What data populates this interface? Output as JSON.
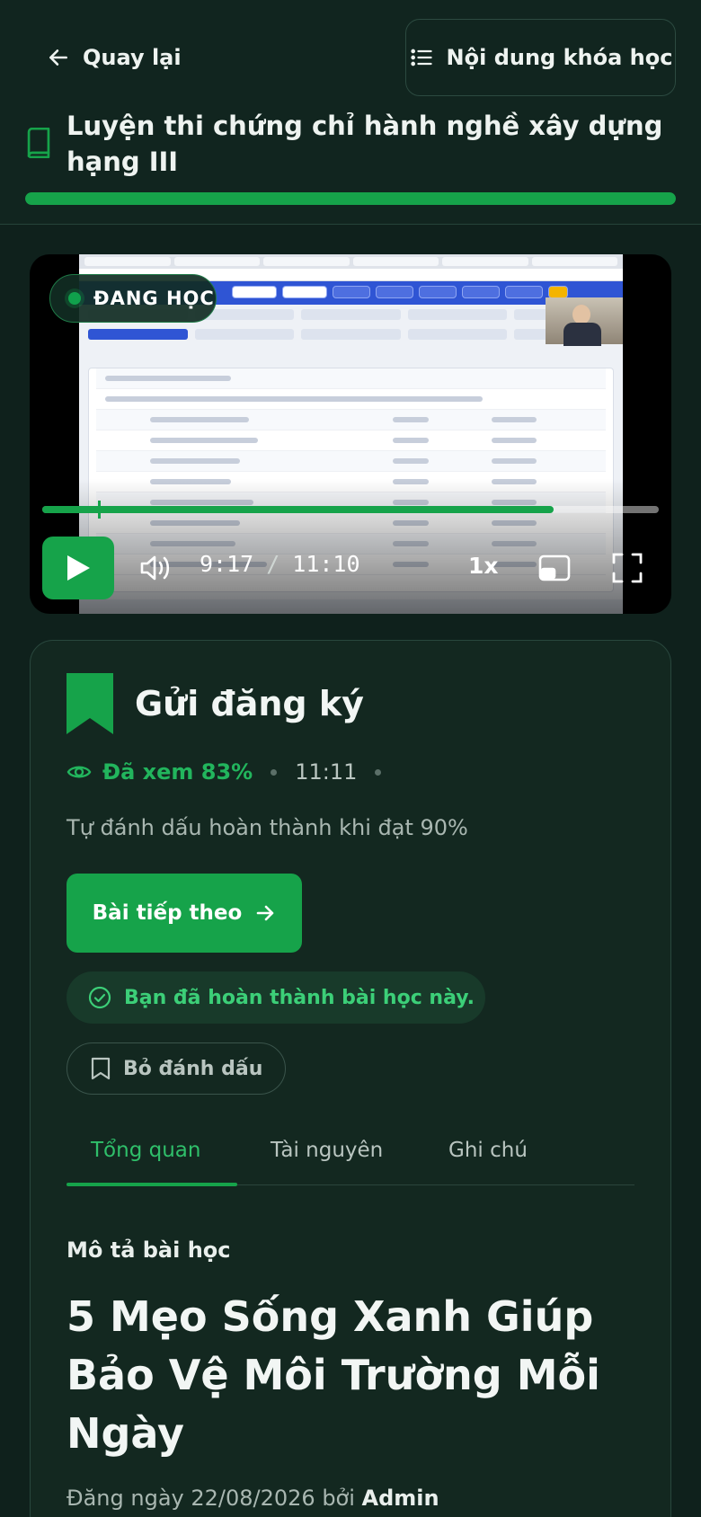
{
  "header": {
    "back_label": "Quay lại",
    "course_content_label": "Nội dung khóa học",
    "course_title": "Luyện thi chứng chỉ hành nghề xây dựng hạng III",
    "course_progress": 1.0
  },
  "player": {
    "status_badge": "ĐANG HỌC",
    "current_time": "9:17",
    "separator": "/",
    "duration": "11:10",
    "speed": "1x",
    "played_fraction": 0.83,
    "accent_color": "#16a34a"
  },
  "lesson": {
    "title": "Gửi đăng ký",
    "watched": "Đã xem 83%",
    "length": "11:11",
    "auto_complete_note": "Tự đánh dấu hoàn thành khi đạt 90%",
    "next_label": "Bài tiếp theo",
    "completed_message": "Bạn đã hoàn thành bài học này.",
    "unmark_label": "Bỏ đánh dấu"
  },
  "tabs": {
    "items": [
      {
        "label": "Tổng quan"
      },
      {
        "label": "Tài nguyên"
      },
      {
        "label": "Ghi chú"
      }
    ]
  },
  "overview": {
    "section_label": "Mô tả bài học",
    "article_title": "5 Mẹo Sống Xanh Giúp Bảo Vệ Môi Trường Mỗi Ngày",
    "posted_prefix": "Đăng ngày 22/08/2026 bởi",
    "author": "Admin"
  },
  "icons": {
    "back": "arrow-left-icon",
    "content": "list-icon",
    "course": "book-icon",
    "play": "play-icon",
    "volume": "volume-icon",
    "pip": "picture-in-picture-icon",
    "fullscreen": "fullscreen-icon",
    "bookmark": "bookmark-icon",
    "eye": "eye-icon",
    "arrow_right": "arrow-right-icon",
    "check": "check-circle-icon"
  }
}
